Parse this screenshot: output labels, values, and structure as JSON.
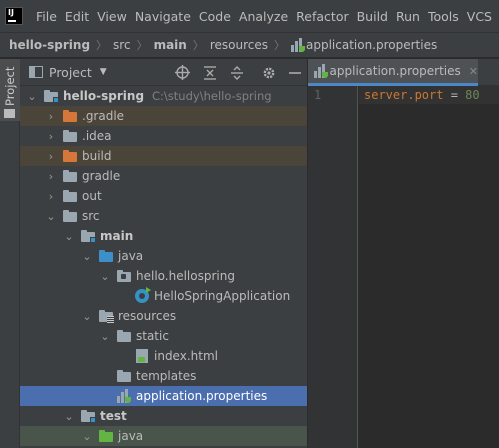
{
  "menu": [
    "File",
    "Edit",
    "View",
    "Navigate",
    "Code",
    "Analyze",
    "Refactor",
    "Build",
    "Run",
    "Tools",
    "VCS"
  ],
  "app_logo_text": "IJ",
  "breadcrumb": [
    "hello-spring",
    "src",
    "main",
    "resources",
    "application.properties"
  ],
  "tool_stripe": {
    "project_label": "Project"
  },
  "project_panel": {
    "title": "Project",
    "dropdown_icon": "chevron-down-icon",
    "header_icons": [
      "locate-icon",
      "collapse-all-icon",
      "expand-all-icon",
      "settings-gear-icon",
      "minimize-icon"
    ],
    "tree": [
      {
        "label": "hello-spring",
        "path": "C:\\study\\hello-spring",
        "depth": 0,
        "expanded": true,
        "icon": "module-folder-icon"
      },
      {
        "label": ".gradle",
        "depth": 1,
        "expanded": false,
        "icon": "excluded-folder-icon"
      },
      {
        "label": ".idea",
        "depth": 1,
        "expanded": false,
        "icon": "folder-icon"
      },
      {
        "label": "build",
        "depth": 1,
        "expanded": false,
        "icon": "excluded-folder-icon"
      },
      {
        "label": "gradle",
        "depth": 1,
        "expanded": false,
        "icon": "folder-icon"
      },
      {
        "label": "out",
        "depth": 1,
        "expanded": false,
        "icon": "folder-icon"
      },
      {
        "label": "src",
        "depth": 1,
        "expanded": true,
        "icon": "folder-icon"
      },
      {
        "label": "main",
        "depth": 2,
        "expanded": true,
        "icon": "module-folder-icon"
      },
      {
        "label": "java",
        "depth": 3,
        "expanded": true,
        "icon": "source-folder-icon"
      },
      {
        "label": "hello.hellospring",
        "depth": 4,
        "expanded": true,
        "icon": "package-icon"
      },
      {
        "label": "HelloSpringApplication",
        "depth": 5,
        "icon": "spring-class-icon"
      },
      {
        "label": "resources",
        "depth": 3,
        "expanded": true,
        "icon": "resources-folder-icon"
      },
      {
        "label": "static",
        "depth": 4,
        "expanded": true,
        "icon": "folder-icon"
      },
      {
        "label": "index.html",
        "depth": 5,
        "icon": "html-file-icon"
      },
      {
        "label": "templates",
        "depth": 4,
        "icon": "folder-icon"
      },
      {
        "label": "application.properties",
        "depth": 4,
        "icon": "properties-file-icon"
      },
      {
        "label": "test",
        "depth": 2,
        "expanded": true,
        "icon": "module-folder-icon"
      },
      {
        "label": "java",
        "depth": 3,
        "expanded": true,
        "icon": "test-source-folder-icon"
      }
    ],
    "selected_item": "application.properties"
  },
  "editor": {
    "tab_label": "application.properties",
    "tab_close": "✕",
    "line_number": "1",
    "code_key": "server.port",
    "code_op": " = ",
    "code_value": "80"
  },
  "colors": {
    "accent": "#4b6eaf",
    "excluded_row": "#4b4539",
    "test_row": "#49544a",
    "excluded_folder": "#d5763a",
    "source_folder": "#3d8fc9",
    "test_folder": "#62b543"
  }
}
